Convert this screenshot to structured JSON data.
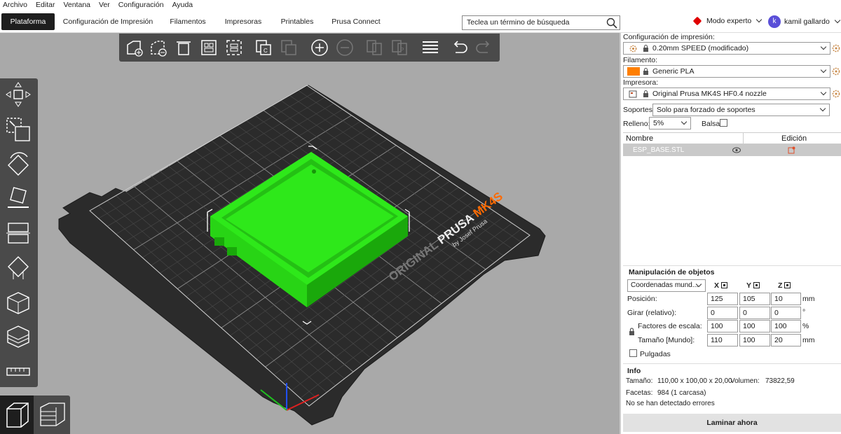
{
  "menu": [
    "Archivo",
    "Editar",
    "Ventana",
    "Ver",
    "Configuración",
    "Ayuda"
  ],
  "tabs": [
    {
      "label": "Plataforma",
      "active": true
    },
    {
      "label": "Configuración de Impresión",
      "active": false
    },
    {
      "label": "Filamentos",
      "active": false
    },
    {
      "label": "Impresoras",
      "active": false
    },
    {
      "label": "Printables",
      "active": false
    },
    {
      "label": "Prusa Connect",
      "active": false
    }
  ],
  "search": {
    "placeholder": "Teclea un término de búsqueda"
  },
  "mode": {
    "label": "Modo experto",
    "color": "#e00000"
  },
  "user": {
    "initial": "k",
    "name": "kamil gallardo",
    "color": "#5a4fd8"
  },
  "bed": {
    "brand_left": "ORIGINAL ",
    "brand_mid": "PRUSA ",
    "brand_model": "MK4S",
    "brand_by": "by Josef Prusa"
  },
  "colors": {
    "model": "#2ee81a",
    "bed": "#2b2b2b",
    "accent": "#ff6a00",
    "viewport": "#a9a9a9"
  },
  "sidebar": {
    "print_settings_label": "Configuración de impresión:",
    "print_settings_value": "0.20mm SPEED (modificado)",
    "filament_label": "Filamento:",
    "filament_value": "Generic PLA",
    "filament_color": "#ff7f00",
    "printer_label": "Impresora:",
    "printer_value": "Original Prusa MK4S HF0.4 nozzle",
    "supports_label": "Soportes:",
    "supports_value": "Solo para forzado de soportes",
    "infill_label": "Relleno:",
    "infill_value": "5%",
    "brim_label": "Balsa:",
    "brim_checked": false,
    "col_name": "Nombre",
    "col_edit": "Edición",
    "objects": [
      {
        "name": "ESP_BASE.STL"
      }
    ]
  },
  "manipulation": {
    "title": "Manipulación de objetos",
    "coords_value": "Coordenadas mund...",
    "axis_x": "X",
    "axis_y": "Y",
    "axis_z": "Z",
    "position_label": "Posición:",
    "position": [
      "125",
      "105",
      "10"
    ],
    "position_unit": "mm",
    "rotate_label": "Girar (relativo):",
    "rotate": [
      "0",
      "0",
      "0"
    ],
    "rotate_unit": "°",
    "scale_label": "Factores de escala:",
    "scale": [
      "100",
      "100",
      "100"
    ],
    "scale_unit": "%",
    "size_label": "Tamaño [Mundo]:",
    "size": [
      "110",
      "100",
      "20"
    ],
    "size_unit": "mm",
    "inches_label": "Pulgadas",
    "inches_checked": false
  },
  "info": {
    "title": "Info",
    "size_label": "Tamaño:",
    "size_value": "110,00 x 100,00 x 20,00",
    "volume_label": "Volumen:",
    "volume_value": "73822,59",
    "facets_label": "Facetas:",
    "facets_value": "984 (1 carcasa)",
    "errors": "No se han detectado errores"
  },
  "slice_button": "Laminar ahora"
}
